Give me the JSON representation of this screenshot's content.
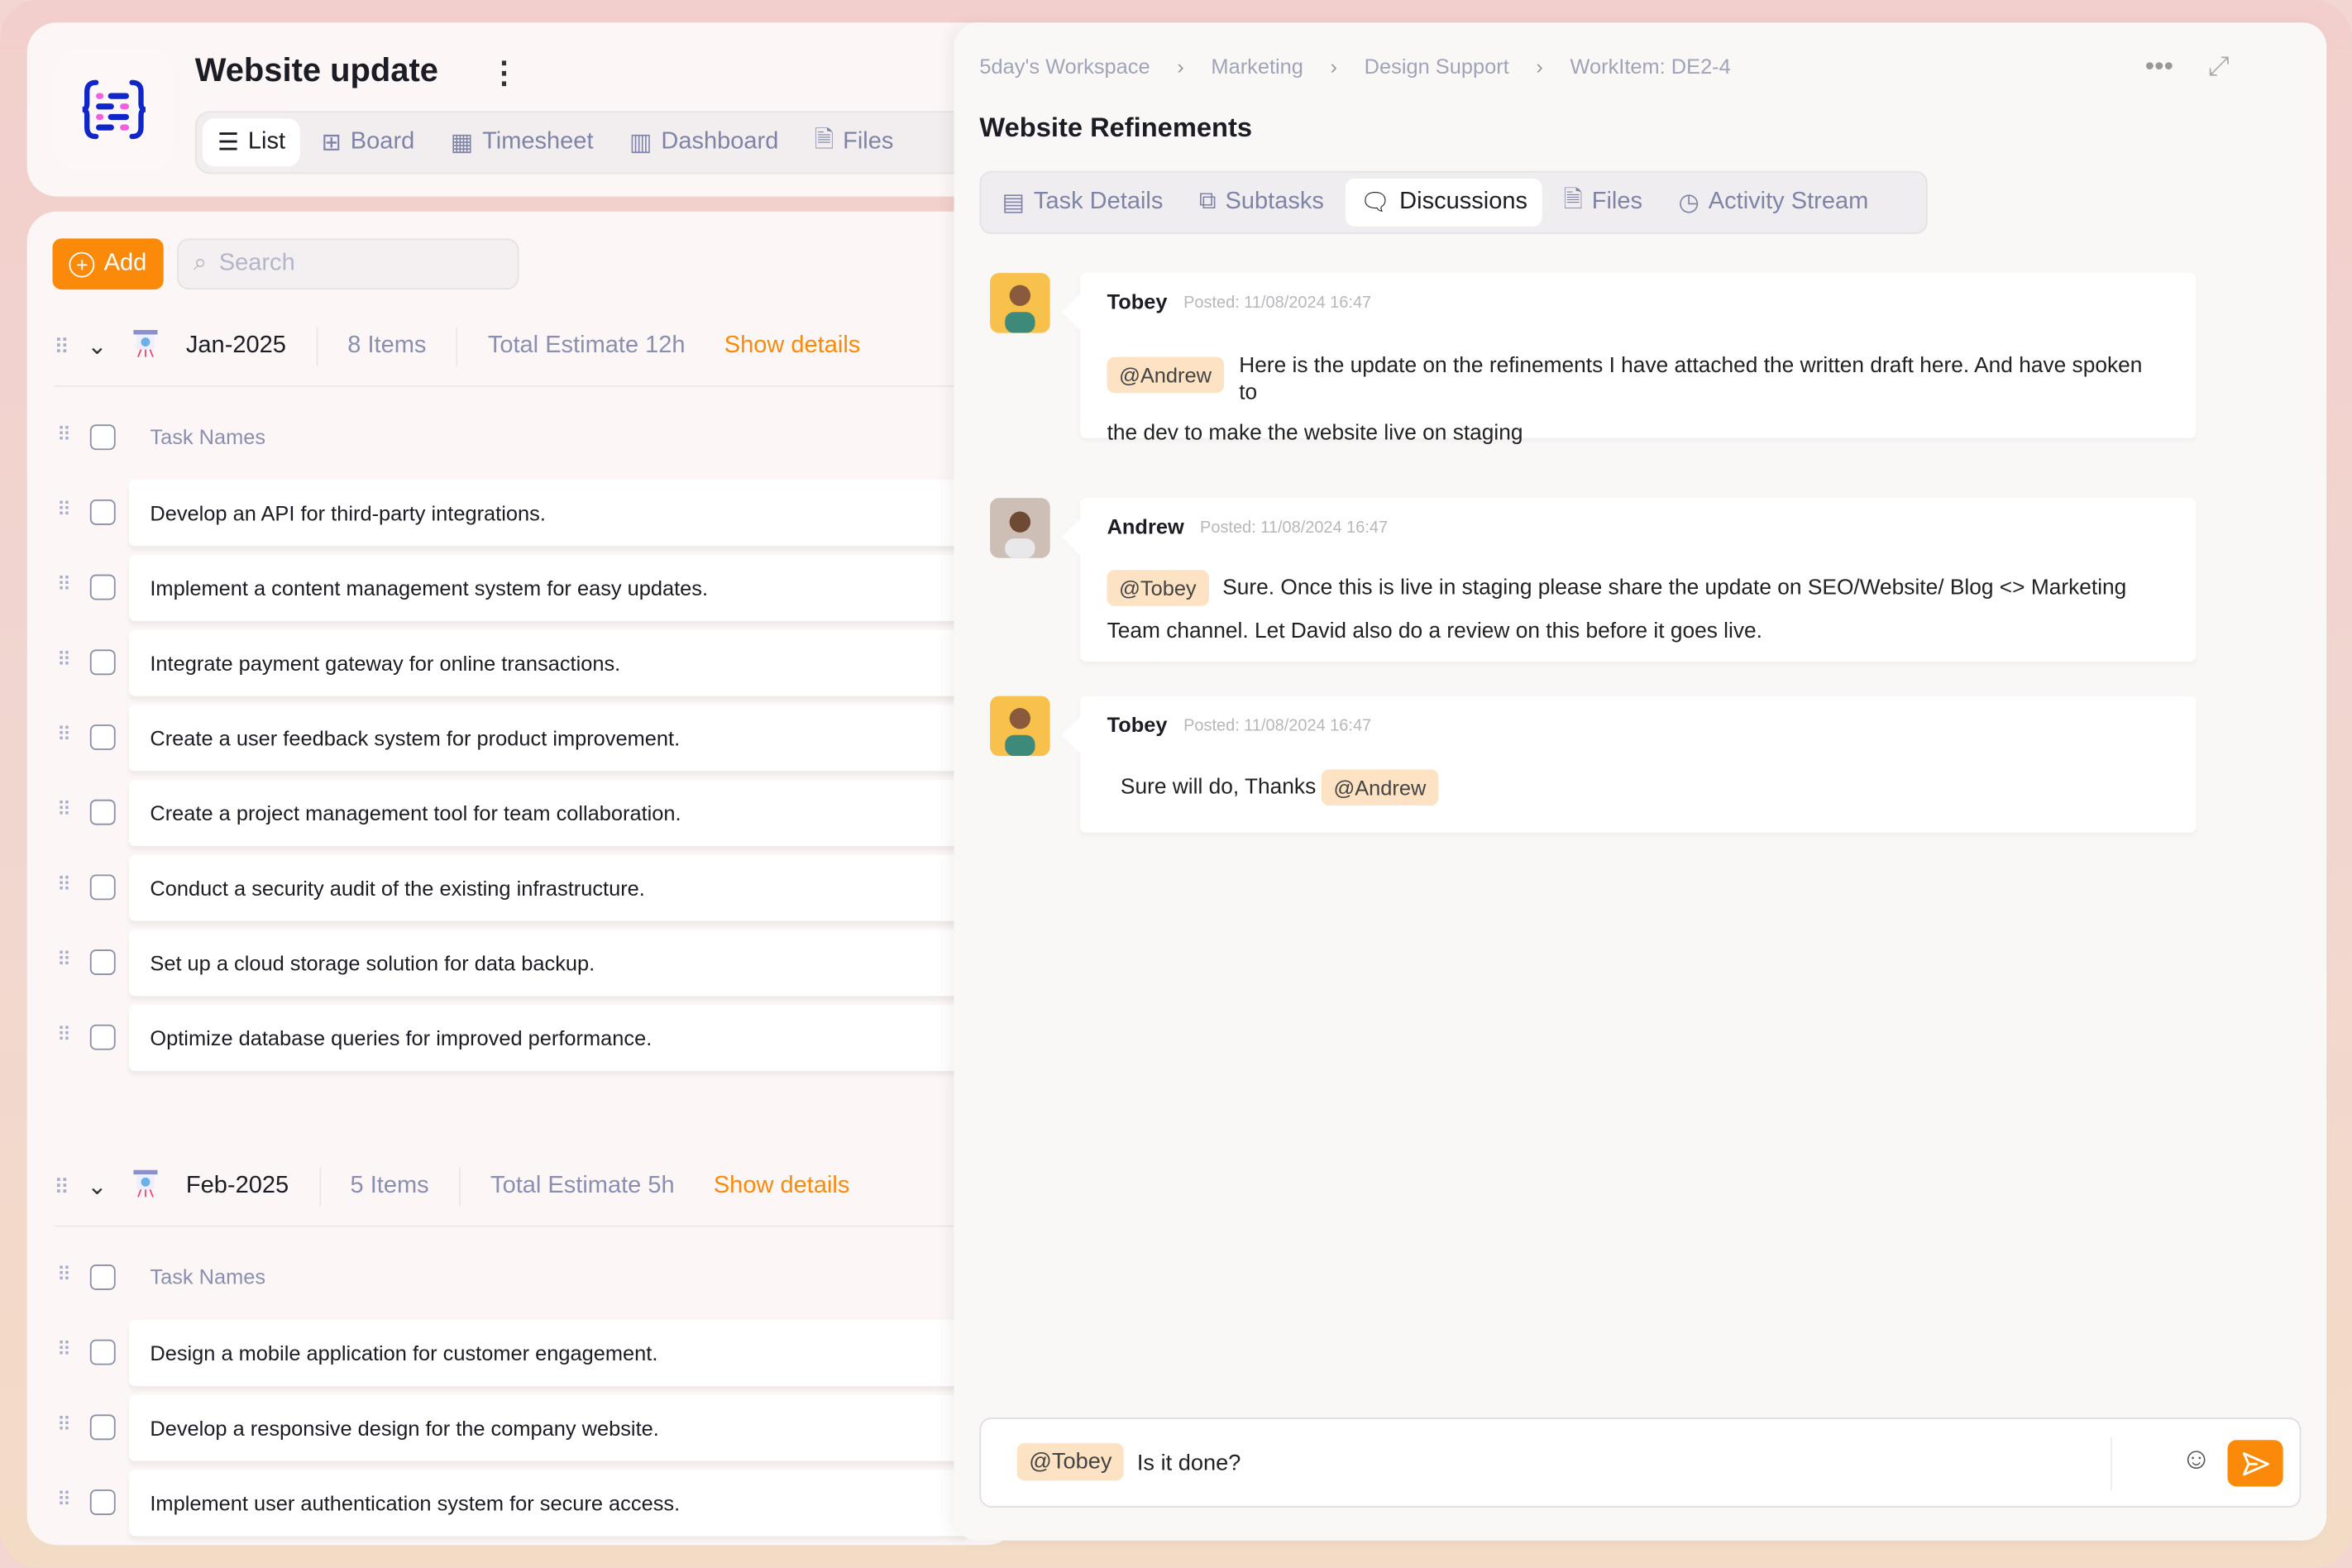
{
  "project": {
    "title": "Website update"
  },
  "view_tabs": [
    {
      "label": "List",
      "icon": "list-icon"
    },
    {
      "label": "Board",
      "icon": "board-icon"
    },
    {
      "label": "Timesheet",
      "icon": "calendar-clock-icon"
    },
    {
      "label": "Dashboard",
      "icon": "chart-icon"
    },
    {
      "label": "Files",
      "icon": "file-icon"
    }
  ],
  "toolbar": {
    "add_label": "Add",
    "search_placeholder": "Search"
  },
  "groups": [
    {
      "name": "Jan-2025",
      "count": "8 Items",
      "estimate": "Total Estimate 12h",
      "show": "Show details",
      "header": "Task Names",
      "tasks": [
        "Develop an API for third-party integrations.",
        "Implement a content management system for easy updates.",
        "Integrate payment gateway for online transactions.",
        "Create a user feedback system for product improvement.",
        "Create a project management tool for team collaboration.",
        "Conduct a security audit of the existing infrastructure.",
        "Set up a cloud storage solution for data backup.",
        "Optimize database queries for improved performance."
      ]
    },
    {
      "name": "Feb-2025",
      "count": "5 Items",
      "estimate": "Total Estimate 5h",
      "show": "Show details",
      "header": "Task Names",
      "tasks": [
        "Design a mobile application for customer engagement.",
        "Develop a responsive design for the company website.",
        "Implement user authentication system for secure access."
      ]
    }
  ],
  "detail": {
    "breadcrumbs": [
      "5day's Workspace",
      "Marketing",
      "Design Support",
      "WorkItem: DE2-4"
    ],
    "title": "Website Refinements",
    "tabs": [
      "Task Details",
      "Subtasks",
      "Discussions",
      "Files",
      "Activity Stream"
    ],
    "active_tab": "Discussions",
    "messages": [
      {
        "author": "Tobey",
        "time": "Posted: 11/08/2024 16:47",
        "mention": "@Andrew",
        "text": "Here is the update on the refinements I have attached the written draft here. And have spoken to",
        "text2": "the dev to make the website live on staging"
      },
      {
        "author": "Andrew",
        "time": "Posted: 11/08/2024 16:47",
        "mention": "@Tobey",
        "text": "Sure. Once this is live in staging please share the update on SEO/Website/ Blog <> Marketing",
        "text2": "Team channel.  Let David also do a review on this before it goes live."
      },
      {
        "author": "Tobey",
        "time": "Posted: 11/08/2024 16:47",
        "text": "Sure will do, Thanks",
        "mention": "@Andrew"
      }
    ],
    "composer": {
      "mention": "@Tobey",
      "text": "Is it done?"
    }
  },
  "colors": {
    "accent": "#fb8a0a",
    "mention_bg": "#fde3c3",
    "muted": "#8a8fb0"
  }
}
